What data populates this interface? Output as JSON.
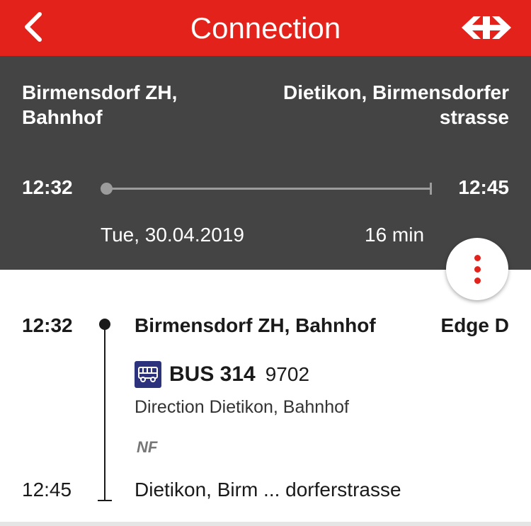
{
  "header": {
    "title": "Connection",
    "back_icon": "chevron-left-icon",
    "logo_icon": "sbb-logo-icon",
    "bar_color": "#e3231b"
  },
  "summary": {
    "from": "Birmensdorf ZH, Bahnhof",
    "to": "Dietikon, Birmensdorferstrasse",
    "departure": "12:32",
    "arrival": "12:45",
    "date": "Tue, 30.04.2019",
    "duration": "16 min",
    "background": "#444444"
  },
  "journey": {
    "departure_time": "12:32",
    "departure_stop": "Birmensdorf ZH, Bahnhof",
    "platform": "Edge D",
    "transport": {
      "icon": "bus-icon",
      "line": "BUS 314",
      "number": "9702",
      "direction": "Direction Dietikon, Bahnhof",
      "note": "NF"
    },
    "arrival_time": "12:45",
    "arrival_stop": "Dietikon, Birm ... dorferstrasse"
  },
  "actions": {
    "more_icon": "more-vertical-icon"
  }
}
